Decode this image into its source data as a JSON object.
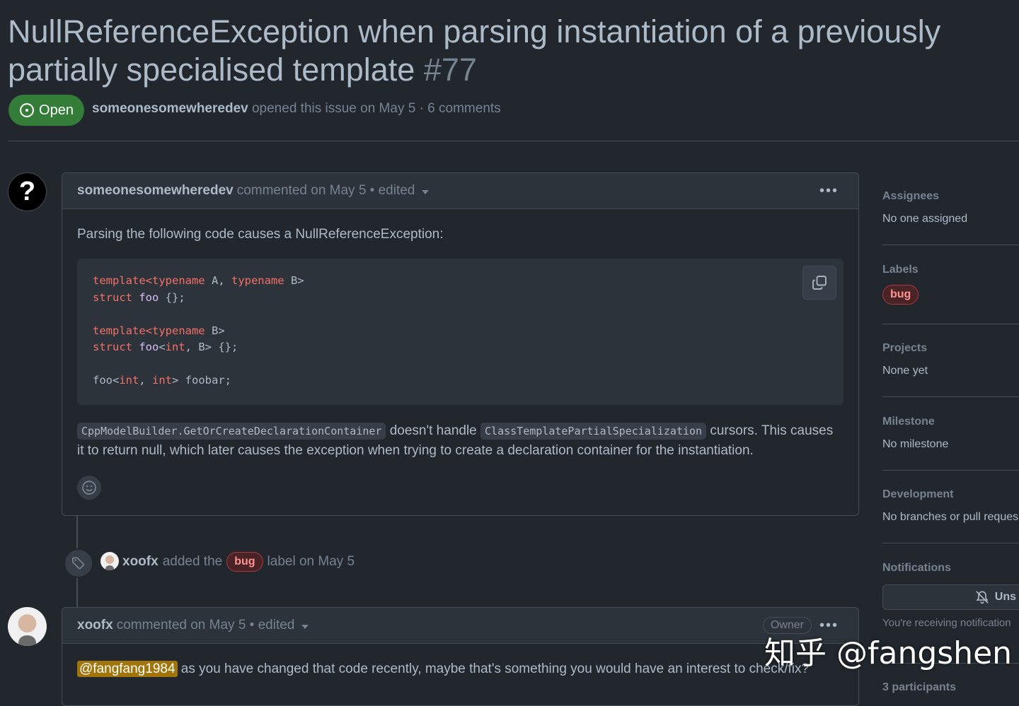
{
  "issue": {
    "title": "NullReferenceException when parsing instantiation of a previously partially specialised template",
    "number": "#77",
    "state": "Open",
    "author": "someonesomewheredev",
    "meta_text": "opened this issue on May 5 · 6 comments"
  },
  "comment1": {
    "avatar_symbol": "?",
    "author": "someonesomewheredev",
    "meta": "commented on May 5 • edited",
    "kebab": "•••",
    "intro": "Parsing the following code causes a NullReferenceException:",
    "code": {
      "l1_kw1": "template",
      "l1_kw2": "<typename",
      "l1_a": " A, ",
      "l1_kw3": "typename",
      "l1_b": " B>",
      "l2_kw": "struct",
      "l2_name": " foo",
      "l2_rest": " {};",
      "l4_kw1": "template",
      "l4_kw2": "<typename",
      "l4_rest": " B>",
      "l5_kw": "struct",
      "l5_name": " foo",
      "l5_lt": "<",
      "l5_int": "int",
      "l5_rest": ", B> {};",
      "l7_a": "foo<",
      "l7_int1": "int",
      "l7_comma": ", ",
      "l7_int2": "int",
      "l7_rest": "> foobar;"
    },
    "code_inline_1": "CppModelBuilder.GetOrCreateDeclarationContainer",
    "text_part_1": " doesn't handle ",
    "code_inline_2": "ClassTemplatePartialSpecialization",
    "text_part_2": " cursors. This causes it to return null, which later causes the exception when trying to create a declaration container for the instantiation."
  },
  "event": {
    "author": "xoofx",
    "text_before": "added the",
    "label": "bug",
    "text_after": "label on May 5"
  },
  "comment2": {
    "author": "xoofx",
    "meta": "commented on May 5 • edited",
    "badge": "Owner",
    "kebab": "•••",
    "mention": "@fangfang1984",
    "text": " as you have changed that code recently, maybe that's something you would have an interest to check/fix?"
  },
  "sidebar": {
    "assignees_title": "Assignees",
    "assignees_value": "No one assigned",
    "labels_title": "Labels",
    "label_bug": "bug",
    "projects_title": "Projects",
    "projects_value": "None yet",
    "milestone_title": "Milestone",
    "milestone_value": "No milestone",
    "development_title": "Development",
    "development_value": "No branches or pull reques",
    "notifications_title": "Notifications",
    "unsubscribe_label": "Uns",
    "notifications_note": "You're receiving notification",
    "participants": "3 participants"
  },
  "watermark": "知乎 @fangshen",
  "colors": {
    "background": "#22272e",
    "open_green": "#347d39",
    "bug_label": "#ff9492",
    "border": "#444c56"
  }
}
